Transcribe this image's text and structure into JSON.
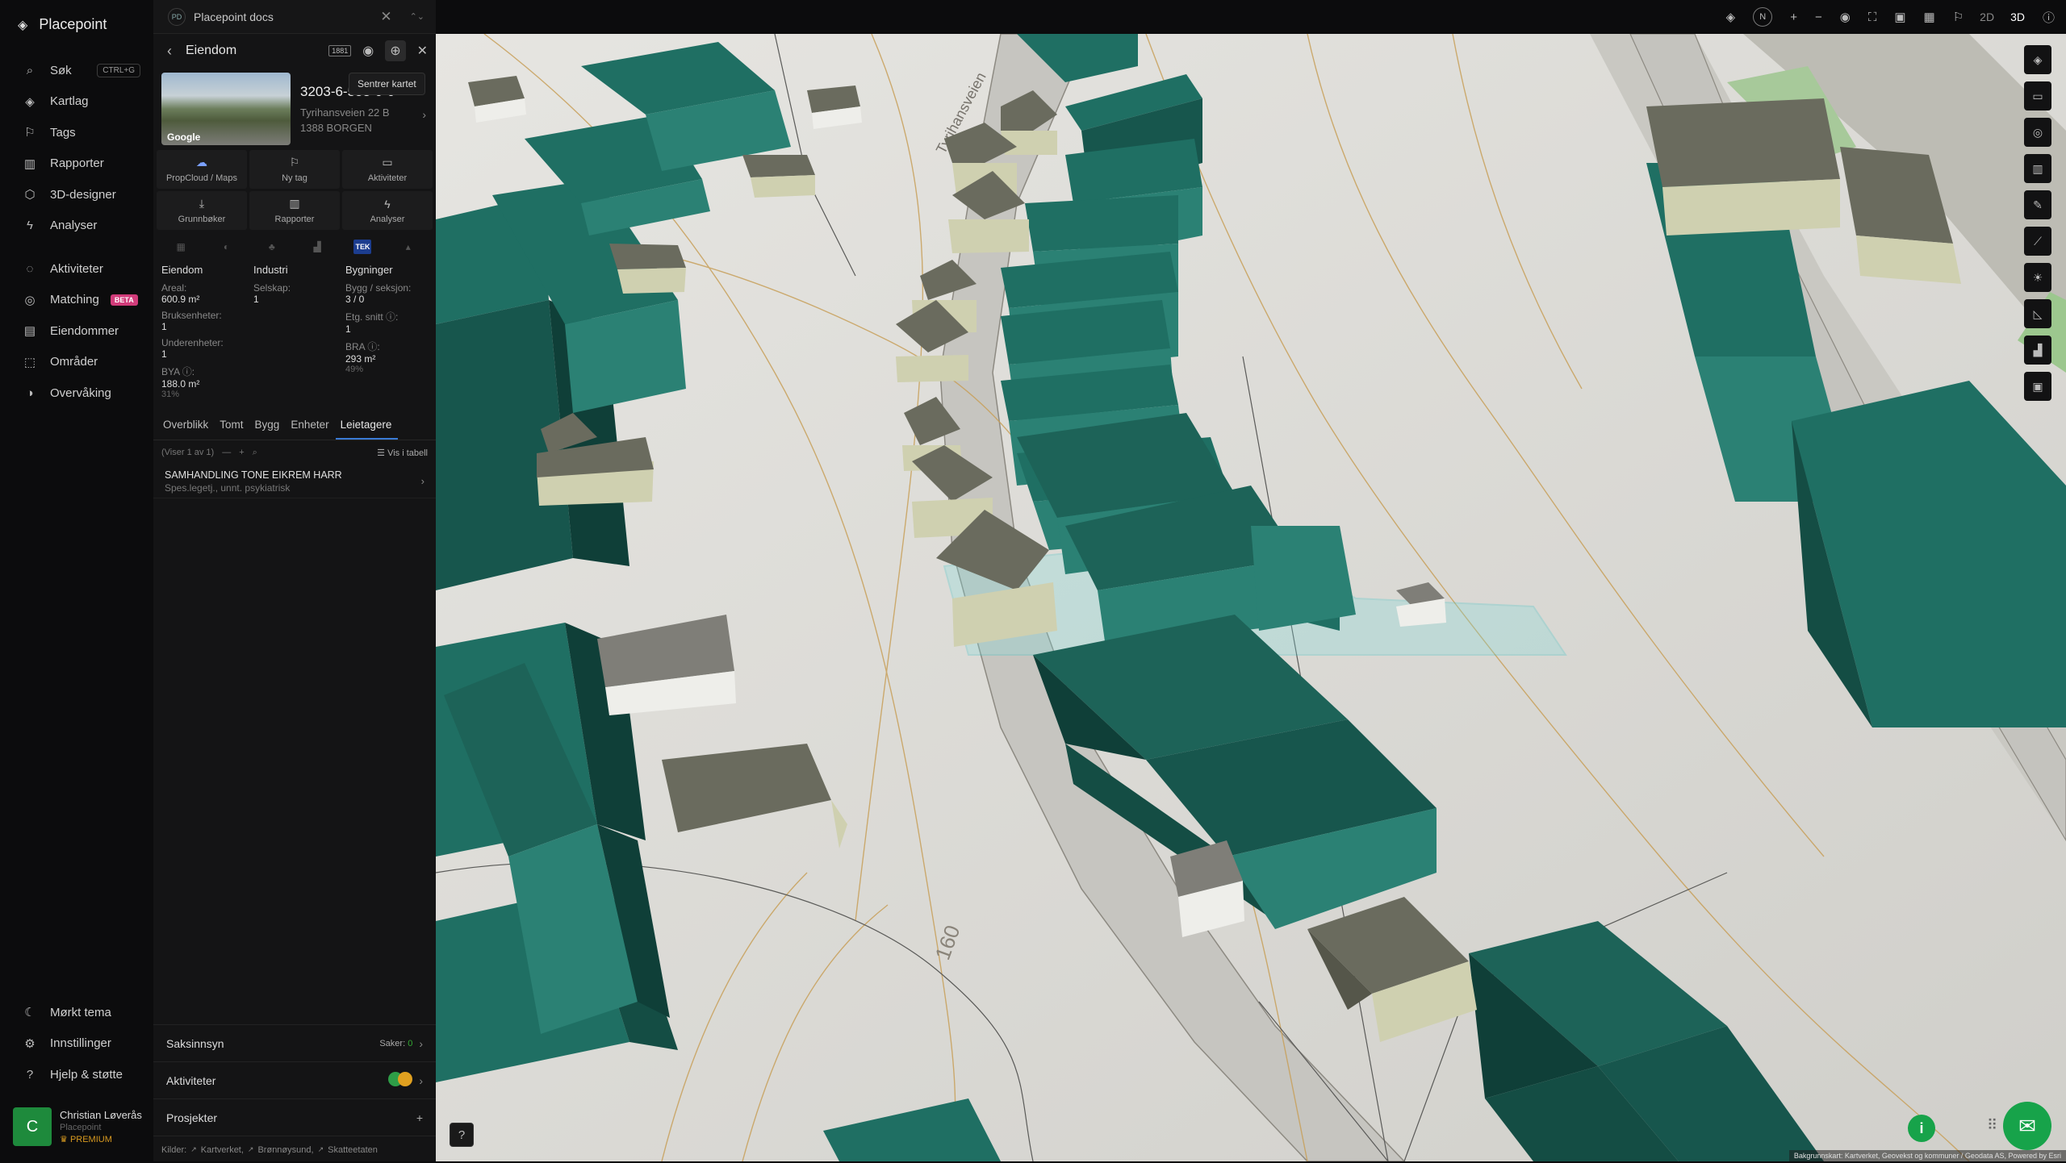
{
  "app": {
    "name": "Placepoint"
  },
  "nav": {
    "items": [
      {
        "name": "nav-search",
        "icon": "search-icon",
        "glyph": "⌕",
        "label": "Søk",
        "kbd": "CTRL+G"
      },
      {
        "name": "nav-kartlag",
        "icon": "layers-icon",
        "glyph": "◈",
        "label": "Kartlag"
      },
      {
        "name": "nav-tags",
        "icon": "bookmark-icon",
        "glyph": "⚐",
        "label": "Tags"
      },
      {
        "name": "nav-rapporter",
        "icon": "chart-icon",
        "glyph": "▥",
        "label": "Rapporter"
      },
      {
        "name": "nav-3d-designer",
        "icon": "cube-icon",
        "glyph": "⬡",
        "label": "3D-designer"
      },
      {
        "name": "nav-analyser",
        "icon": "bolt-icon",
        "glyph": "ϟ",
        "label": "Analyser"
      }
    ],
    "items2": [
      {
        "name": "nav-aktiviteter",
        "icon": "chat-icon",
        "glyph": "◌",
        "label": "Aktiviteter"
      },
      {
        "name": "nav-matching",
        "icon": "target-icon",
        "glyph": "◎",
        "label": "Matching",
        "badge": "BETA"
      },
      {
        "name": "nav-eiendommer",
        "icon": "building-icon",
        "glyph": "▤",
        "label": "Eiendommer"
      },
      {
        "name": "nav-omrader",
        "icon": "area-icon",
        "glyph": "⬚",
        "label": "Områder"
      },
      {
        "name": "nav-overvaking",
        "icon": "monitor-icon",
        "glyph": "◑",
        "label": "Overvåking"
      }
    ],
    "bottom": [
      {
        "name": "nav-dark-theme",
        "icon": "moon-icon",
        "glyph": "☾",
        "label": "Mørkt tema"
      },
      {
        "name": "nav-settings",
        "icon": "gear-icon",
        "glyph": "⚙",
        "label": "Innstillinger"
      },
      {
        "name": "nav-help",
        "icon": "help-icon",
        "glyph": "?",
        "label": "Hjelp & støtte"
      }
    ]
  },
  "user": {
    "initial": "C",
    "name": "Christian Løverås",
    "org": "Placepoint",
    "plan": "PREMIUM"
  },
  "doc": {
    "avatar": "PD",
    "title": "Placepoint docs"
  },
  "panel": {
    "title": "Eiendom",
    "tooltip": "Sentrer kartet",
    "tool_badge": "1881",
    "property": {
      "id": "3203-6-558-0-0",
      "address": "Tyrihansveien 22 B",
      "postal": "1388 BORGEN",
      "thumb_label": "Google"
    },
    "actions": [
      {
        "name": "action-propcloud",
        "icon": "cloud-icon",
        "glyph": "☁",
        "label": "PropCloud / Maps"
      },
      {
        "name": "action-ny-tag",
        "icon": "bookmark-icon",
        "glyph": "⚐",
        "label": "Ny tag"
      },
      {
        "name": "action-aktiviteter",
        "icon": "chat-icon",
        "glyph": "▭",
        "label": "Aktiviteter"
      },
      {
        "name": "action-grunnboker",
        "icon": "download-icon",
        "glyph": "⤓",
        "label": "Grunnbøker"
      },
      {
        "name": "action-rapporter",
        "icon": "chart-icon",
        "glyph": "▥",
        "label": "Rapporter"
      },
      {
        "name": "action-analyser",
        "icon": "bolt-icon",
        "glyph": "ϟ",
        "label": "Analyser"
      }
    ],
    "icon_tek": "TEK",
    "stats": {
      "col1": {
        "header": "Eiendom",
        "fields": [
          {
            "label": "Areal:",
            "value": "600.9 m²"
          },
          {
            "label": "Bruksenheter:",
            "value": "1"
          },
          {
            "label": "Underenheter:",
            "value": "1"
          },
          {
            "label": "BYA ⓘ:",
            "value": "188.0 m²",
            "pct": "31%"
          }
        ]
      },
      "col2": {
        "header": "Industri",
        "fields": [
          {
            "label": "Selskap:",
            "value": "1"
          }
        ]
      },
      "col3": {
        "header": "Bygninger",
        "fields": [
          {
            "label": "Bygg / seksjon:",
            "value": "3 / 0"
          },
          {
            "label": "Etg. snitt ⓘ:",
            "value": "1"
          },
          {
            "label": "BRA ⓘ:",
            "value": "293 m²",
            "pct": "49%"
          }
        ]
      }
    },
    "tabs": [
      "Overblikk",
      "Tomt",
      "Bygg",
      "Enheter",
      "Leietagere"
    ],
    "list": {
      "count": "(Viser 1 av 1)",
      "table_label": "Vis i tabell"
    },
    "rows": [
      {
        "title": "SAMHANDLING TONE EIKREM HARR",
        "sub": "Spes.legetj., unnt. psykiatrisk"
      }
    ],
    "sections": {
      "saksinnsyn": "Saksinnsyn",
      "saker_label": "Saker:",
      "saker_count": "0",
      "aktiviteter": "Aktiviteter",
      "prosjekter": "Prosjekter"
    },
    "sources": {
      "label": "Kilder:",
      "items": [
        "Kartverket,",
        "Brønnøysund,",
        "Skatteetaten"
      ]
    }
  },
  "map": {
    "mode_2d": "2D",
    "mode_3d": "3D",
    "north": "N",
    "attribution": "Bakgrunnskart: Kartverket, Geovekst og kommuner / Geodata AS, Powered by Esri",
    "road_label": "Tyrihansveien",
    "contour_label": "160",
    "colors": {
      "building": "#1f6f63",
      "building_dark": "#144d44",
      "house": "#cfd0b0",
      "roof": "#6a6b5e",
      "selection": "#7ddcdc"
    }
  }
}
